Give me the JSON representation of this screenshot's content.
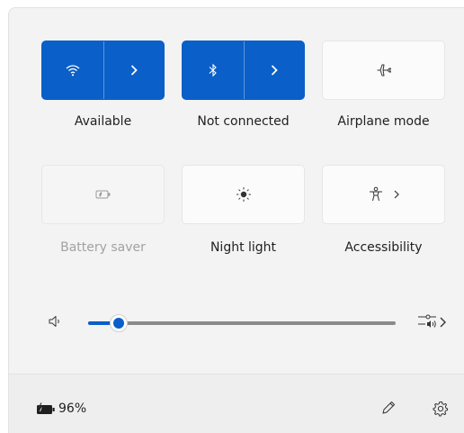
{
  "quick_settings": {
    "tiles": [
      {
        "id": "wifi",
        "label": "Available",
        "icon": "wifi-icon",
        "state": "on",
        "has_chevron": true
      },
      {
        "id": "bluetooth",
        "label": "Not connected",
        "icon": "bluetooth-icon",
        "state": "on",
        "has_chevron": true
      },
      {
        "id": "airplane",
        "label": "Airplane mode",
        "icon": "airplane-icon",
        "state": "off"
      },
      {
        "id": "battery_saver",
        "label": "Battery saver",
        "icon": "battery-saver-icon",
        "state": "disabled"
      },
      {
        "id": "night_light",
        "label": "Night light",
        "icon": "brightness-icon",
        "state": "off"
      },
      {
        "id": "accessibility",
        "label": "Accessibility",
        "icon": "accessibility-icon",
        "state": "off",
        "has_chevron": true
      }
    ],
    "volume": {
      "icon": "speaker-icon",
      "level_fraction": 0.1,
      "output_icon": "audio-output-icon"
    }
  },
  "footer": {
    "battery_icon": "battery-charging-icon",
    "battery_percent": "96%",
    "edit_icon": "pencil-icon",
    "settings_icon": "gear-icon"
  },
  "colors": {
    "accent": "#0a5fc8",
    "panel_bg": "#f3f3f3",
    "footer_bg": "#eeeeee",
    "disabled_text": "#a2a2a2"
  }
}
